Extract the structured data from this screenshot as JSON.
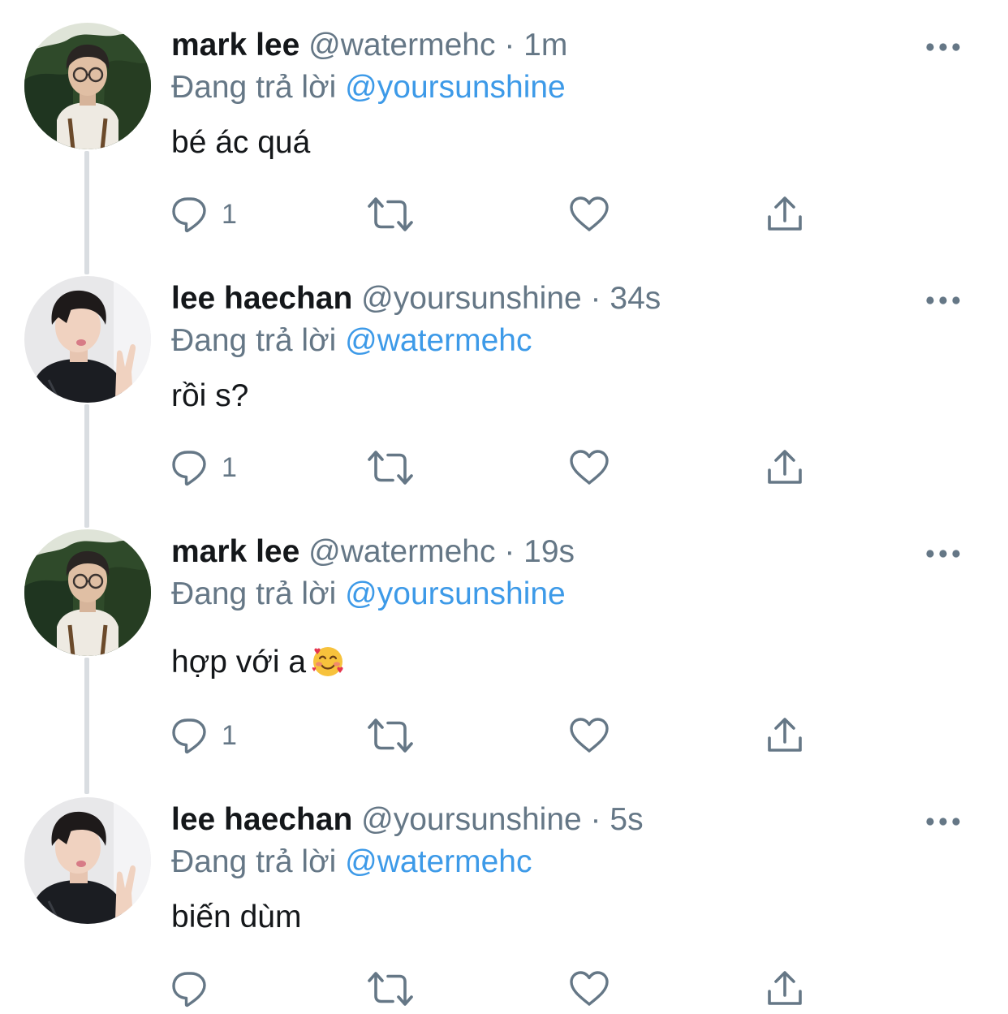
{
  "thread": {
    "tweets": [
      {
        "author": {
          "name": "mark lee",
          "handle": "@watermehc",
          "avatar": "avatar-mark"
        },
        "separator": "·",
        "time": "1m",
        "replying_prefix": "Đang trả lời",
        "replying_to": "@yoursunshine",
        "text": "bé ác quá",
        "emoji": "",
        "reply_count": "1",
        "icons": [
          "reply-icon",
          "retweet-icon",
          "like-icon",
          "share-icon",
          "more-icon"
        ]
      },
      {
        "author": {
          "name": "lee haechan",
          "handle": "@yoursunshine",
          "avatar": "avatar-haechan"
        },
        "separator": "·",
        "time": "34s",
        "replying_prefix": "Đang trả lời",
        "replying_to": "@watermehc",
        "text": "rồi s?",
        "emoji": "",
        "reply_count": "1",
        "icons": [
          "reply-icon",
          "retweet-icon",
          "like-icon",
          "share-icon",
          "more-icon"
        ]
      },
      {
        "author": {
          "name": "mark lee",
          "handle": "@watermehc",
          "avatar": "avatar-mark"
        },
        "separator": "·",
        "time": "19s",
        "replying_prefix": "Đang trả lời",
        "replying_to": "@yoursunshine",
        "text": "hợp với a",
        "emoji": "smiling-face-with-hearts",
        "reply_count": "1",
        "icons": [
          "reply-icon",
          "retweet-icon",
          "like-icon",
          "share-icon",
          "more-icon"
        ]
      },
      {
        "author": {
          "name": "lee haechan",
          "handle": "@yoursunshine",
          "avatar": "avatar-haechan"
        },
        "separator": "·",
        "time": "5s",
        "replying_prefix": "Đang trả lời",
        "replying_to": "@watermehc",
        "text": "biến dùm",
        "emoji": "",
        "reply_count": "",
        "icons": [
          "reply-icon",
          "retweet-icon",
          "like-icon",
          "share-icon",
          "more-icon"
        ]
      }
    ]
  },
  "colors": {
    "text": "#14171a",
    "secondary": "#657786",
    "mention": "#3d9ae8",
    "thread_line": "#d9dde1",
    "background": "#ffffff"
  }
}
